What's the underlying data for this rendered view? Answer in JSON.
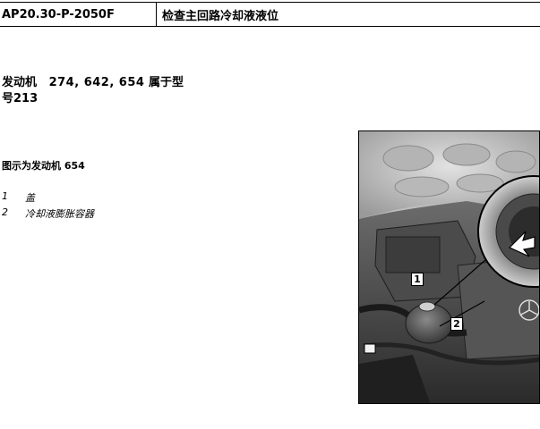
{
  "header": {
    "doc_id": "AP20.30-P-2050F",
    "title": "检查主回路冷却液液位"
  },
  "engine": {
    "label": "发动机",
    "engines": "274, 642, 654",
    "belongs": "属于型号",
    "model": "213"
  },
  "figure": {
    "caption": "图示为发动机 654",
    "callouts": [
      "1",
      "2"
    ]
  },
  "legend": [
    {
      "num": "1",
      "text": "盖"
    },
    {
      "num": "2",
      "text": "冷却液膨胀容器"
    }
  ]
}
